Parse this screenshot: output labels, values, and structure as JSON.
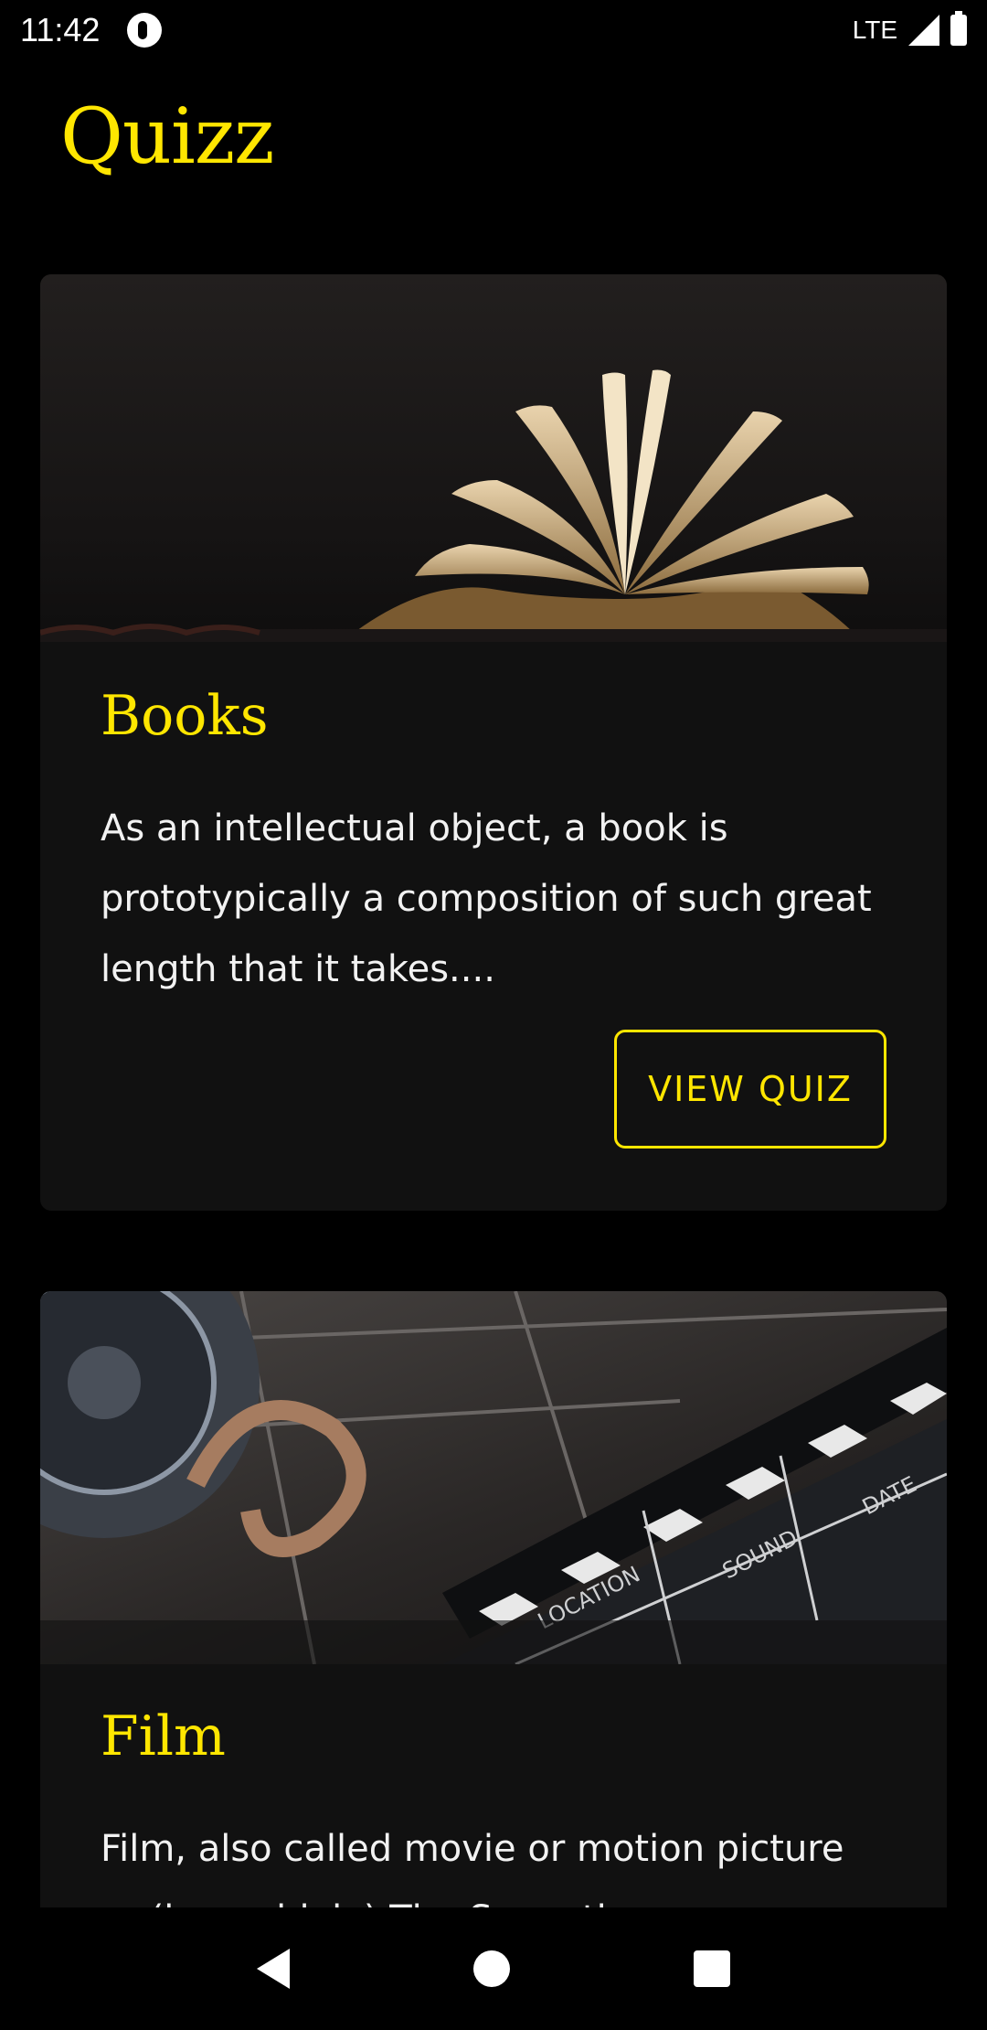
{
  "status_bar": {
    "time": "11:42",
    "network": "LTE"
  },
  "app": {
    "title": "Quizz"
  },
  "cards": [
    {
      "title": "Books",
      "description": "As an intellectual object, a book is prototypically a composition of such great length that it takes....",
      "button_label": "VIEW QUIZ",
      "image_icon": "open-book-icon"
    },
    {
      "title": "Film",
      "description": "Film, also called movie or motion picture or (less widely) The Seventh",
      "image_icon": "film-clapperboard-icon",
      "clapper_labels": [
        "LOCATION",
        "SOUND",
        "DATE"
      ]
    }
  ],
  "nav_bar": {
    "icons": [
      "back-icon",
      "home-icon",
      "recents-icon"
    ]
  },
  "colors": {
    "accent": "#ffe600",
    "background": "#000000",
    "card": "#111111"
  }
}
